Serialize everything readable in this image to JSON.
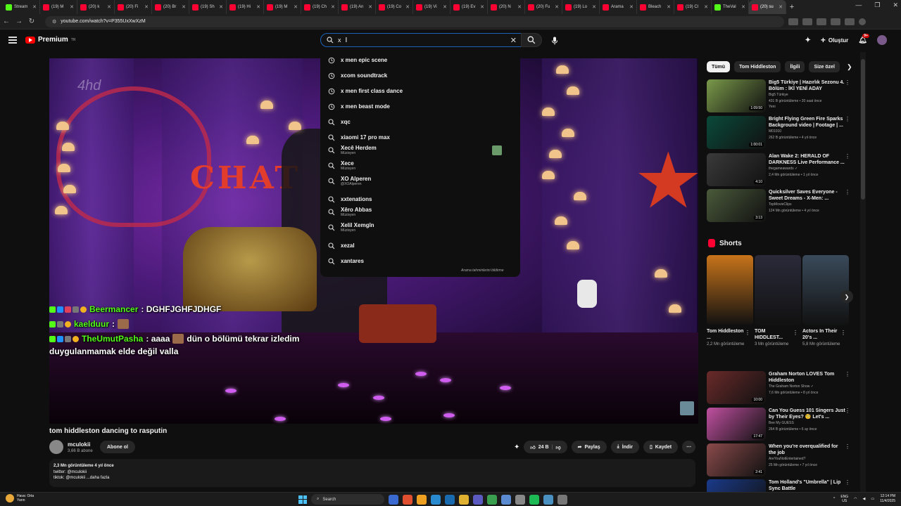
{
  "browser": {
    "tabs": [
      {
        "label": "Stream",
        "icon": "kick-icon",
        "color": "#53fc18",
        "active": false
      },
      {
        "label": "(19) M",
        "icon": "youtube-icon",
        "color": "#ff0033",
        "active": false
      },
      {
        "label": "(20) k",
        "icon": "youtube-icon",
        "color": "#ff0033",
        "active": false
      },
      {
        "label": "(20) Fi",
        "icon": "youtube-icon",
        "color": "#ff0033",
        "active": false
      },
      {
        "label": "(20) Br",
        "icon": "youtube-icon",
        "color": "#ff0033",
        "active": false
      },
      {
        "label": "(19) Sh",
        "icon": "youtube-icon",
        "color": "#ff0033",
        "active": false
      },
      {
        "label": "(19) Hi",
        "icon": "youtube-icon",
        "color": "#ff0033",
        "active": false
      },
      {
        "label": "(19) M",
        "icon": "youtube-icon",
        "color": "#ff0033",
        "active": false
      },
      {
        "label": "(19) Ch",
        "icon": "youtube-icon",
        "color": "#ff0033",
        "active": false
      },
      {
        "label": "(19) An",
        "icon": "youtube-icon",
        "color": "#ff0033",
        "active": false
      },
      {
        "label": "(19) Co",
        "icon": "youtube-icon",
        "color": "#ff0033",
        "active": false
      },
      {
        "label": "(19) Vi",
        "icon": "youtube-icon",
        "color": "#ff0033",
        "active": false
      },
      {
        "label": "(19) Ev",
        "icon": "youtube-icon",
        "color": "#ff0033",
        "active": false
      },
      {
        "label": "(20) N",
        "icon": "youtube-icon",
        "color": "#ff0033",
        "active": false
      },
      {
        "label": "(20) Fu",
        "icon": "youtube-icon",
        "color": "#ff0033",
        "active": false
      },
      {
        "label": "(19) Lo",
        "icon": "youtube-icon",
        "color": "#ff0033",
        "active": false
      },
      {
        "label": "Arama",
        "icon": "search-tab-icon",
        "color": "#ff0033",
        "active": false
      },
      {
        "label": "Bleach",
        "icon": "youtube-icon",
        "color": "#ff0033",
        "active": false
      },
      {
        "label": "(19) Cl",
        "icon": "youtube-icon",
        "color": "#ff0033",
        "active": false
      },
      {
        "label": "TheVal",
        "icon": "kick-icon",
        "color": "#53fc18",
        "active": false
      },
      {
        "label": "(20) su",
        "icon": "youtube-icon",
        "color": "#ff0033",
        "active": true
      }
    ],
    "url": "youtube.com/watch?v=P355UxXwXzM"
  },
  "header": {
    "logo_text": "Premium",
    "logo_sup": "TR",
    "search_value": "x",
    "create_label": "Oluştur",
    "notif_count": "9+"
  },
  "suggestions": {
    "items": [
      {
        "text": "x men epic scene",
        "sub": "",
        "icon": "history-icon"
      },
      {
        "text": "xcom soundtrack",
        "sub": "",
        "icon": "history-icon"
      },
      {
        "text": "x men first class dance",
        "sub": "",
        "icon": "history-icon"
      },
      {
        "text": "x men beast mode",
        "sub": "",
        "icon": "history-icon"
      },
      {
        "text": "xqc",
        "sub": "",
        "icon": "search-icon"
      },
      {
        "text": "xiaomi 17 pro max",
        "sub": "",
        "icon": "search-icon"
      },
      {
        "text": "Xecê Herdem",
        "sub": "Müzisyen",
        "icon": "search-icon"
      },
      {
        "text": "Xece",
        "sub": "Müzisyen",
        "icon": "search-icon"
      },
      {
        "text": "XO Alperen",
        "sub": "@XOAlperen",
        "icon": "search-icon"
      },
      {
        "text": "xxtenations",
        "sub": "",
        "icon": "search-icon"
      },
      {
        "text": "Xêro Abbas",
        "sub": "Müzisyen",
        "icon": "search-icon"
      },
      {
        "text": "Xelil Xemgîn",
        "sub": "Müzisyen",
        "icon": "search-icon"
      },
      {
        "text": "xezal",
        "sub": "",
        "icon": "search-icon"
      },
      {
        "text": "xantares",
        "sub": "",
        "icon": "search-icon"
      }
    ],
    "report": "Arama tahminlerini bildirme"
  },
  "chat": [
    {
      "user": "Beermancer",
      "msg": ": DGHFJGHFJDHGF",
      "user_color": "#53fc18"
    },
    {
      "user": "kaelduur",
      "msg": ":",
      "user_color": "#53fc18"
    },
    {
      "user": "TheUmutPasha",
      "msg": ": aaaa",
      "msg2": "dün o bölümü tekrar izledim",
      "user_color": "#53fc18"
    },
    {
      "user": "",
      "msg": "duygulanmamak elde değil valla",
      "user_color": "#ffffff"
    }
  ],
  "video": {
    "title": "tom hiddleston dancing to rasputin",
    "channel": "mculokii",
    "subs": "3,66 B abone",
    "subscribe": "Abone ol",
    "likes": "24 B",
    "share": "Paylaş",
    "download": "İndir",
    "save": "Kaydet",
    "stats": "2,3 Mn görüntüleme  4 yıl önce",
    "desc1": "twitter: @mculokii",
    "desc2": "tiktok: @mculokii ...daha fazla"
  },
  "chips": [
    "Tümü",
    "Tom Hiddleston",
    "İlgili",
    "Size özel"
  ],
  "recs_top": [
    {
      "title": "Big5 Türkiye | Hazırlık Sezonu 4. Bölüm : İKİ YENİ ADAY",
      "channel": "Big5 Türkiye",
      "meta": "431 B görüntüleme • 20 saat önce",
      "badge": "Yeni",
      "dur": "1:09:50",
      "color": "#7a9a4a"
    },
    {
      "title": "Bright Flying Green Fire Sparks Background video | Footage | ...",
      "channel": "M01010",
      "meta": "262 B görüntüleme • 4 yıl önce",
      "badge": "",
      "dur": "1:00:01",
      "color": "#0a4a3a"
    },
    {
      "title": "Alan Wake 2: HERALD OF DARKNESS Live Performance ...",
      "channel": "thegameawards ✓",
      "meta": "2,4 Mn görüntüleme • 1 yıl önce",
      "badge": "",
      "dur": "4:10",
      "color": "#3a3a3a"
    },
    {
      "title": "Quicksilver Saves Everyone - Sweet Dreams - X-Men: ...",
      "channel": "TopMovieClips",
      "meta": "124 Mn görüntüleme • 4 yıl önce",
      "badge": "",
      "dur": "3:13",
      "color": "#4a5a3a"
    }
  ],
  "shorts_title": "Shorts",
  "shorts": [
    {
      "title": "Tom Hiddleston ...",
      "views": "2,2 Mn görüntüleme",
      "color": "#c8741a"
    },
    {
      "title": "TOM HIDDLEST...",
      "views": "3 Mn görüntüleme",
      "color": "#2a2a3a"
    },
    {
      "title": "Actors In Their 20's ...",
      "views": "5,8 Mn görüntüleme",
      "color": "#3a4a5a"
    }
  ],
  "recs_bottom": [
    {
      "title": "Graham Norton LOVES Tom Hiddleston",
      "channel": "The Graham Norton Show ✓",
      "meta": "7,6 Mn görüntüleme • 8 yıl önce",
      "badge": "",
      "dur": "10:00",
      "color": "#6a2a2a"
    },
    {
      "title": "Can You Guess 101 Singers Just by Their Eyes? 🧐 Let's ...",
      "channel": "Bee My GUESS",
      "meta": "264 B görüntüleme • 6 ay önce",
      "badge": "",
      "dur": "17:47",
      "color": "#c050a0"
    },
    {
      "title": "When you're overqualified for the job",
      "channel": "AreYouNotEntertained?",
      "meta": "25 Mn görüntüleme • 7 yıl önce",
      "badge": "",
      "dur": "2:41",
      "color": "#8a4a4a"
    },
    {
      "title": "Tom Holland's \"Umbrella\" | Lip Sync Battle",
      "channel": "",
      "meta": "",
      "badge": "",
      "dur": "",
      "color": "#1a3a8a"
    }
  ],
  "taskbar": {
    "weather1": "Hava: Orta",
    "weather2": "Yarın",
    "search": "Search",
    "lang1": "ENG",
    "lang2": "US",
    "time": "12:14 PM",
    "date": "11/4/2025"
  }
}
